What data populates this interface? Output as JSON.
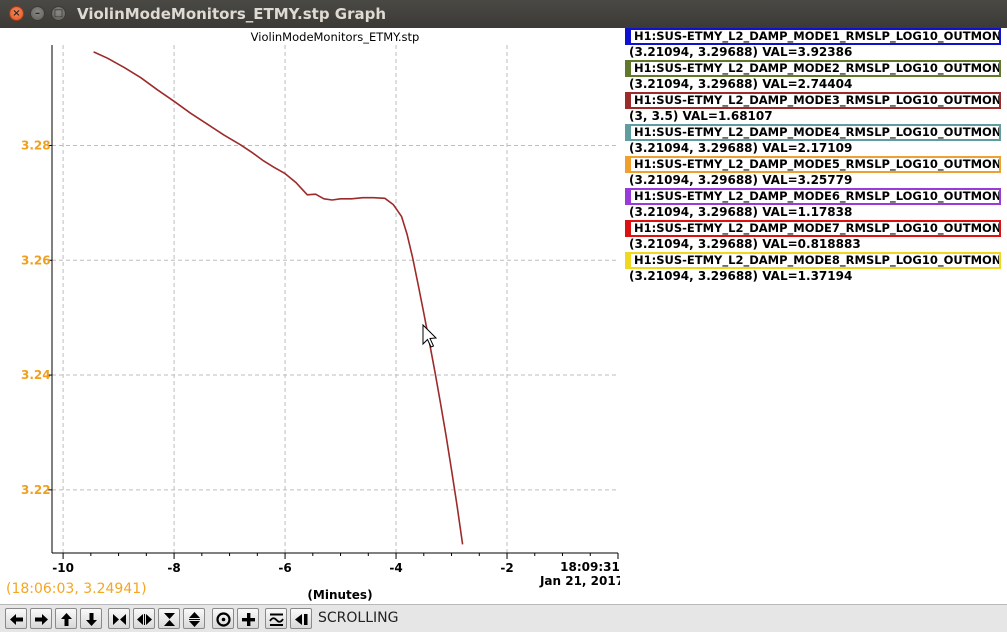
{
  "window": {
    "title": "ViolinModeMonitors_ETMY.stp Graph"
  },
  "graph": {
    "title": "ViolinModeMonitors_ETMY.stp",
    "cursor_readout": "(18:06:03, 3.24941)",
    "xlabel": "(Minutes)",
    "end_time": "18:09:31",
    "end_date": "Jan 21, 2017",
    "readout_color": "#f5a623"
  },
  "chart_data": {
    "type": "line",
    "title": "ViolinModeMonitors_ETMY.stp",
    "xlabel": "(Minutes)",
    "ylabel": "",
    "xlim": [
      -10.2,
      0
    ],
    "ylim": [
      3.209,
      3.2975
    ],
    "grid": true,
    "x_ticks": [
      -10,
      -8,
      -6,
      -4,
      -2
    ],
    "x_tick_labels": [
      "-10",
      "-8",
      "-6",
      "-4",
      "-2"
    ],
    "y_ticks": [
      3.22,
      3.24,
      3.26,
      3.28
    ],
    "y_tick_labels": [
      "3.22",
      "3.24",
      "3.26",
      "3.28"
    ],
    "series": [
      {
        "color": "#9c2b2b",
        "x": [
          -9.45,
          -9.2,
          -8.9,
          -8.6,
          -8.3,
          -8.0,
          -7.7,
          -7.4,
          -7.1,
          -6.8,
          -6.6,
          -6.4,
          -6.2,
          -6.0,
          -5.8,
          -5.6,
          -5.45,
          -5.3,
          -5.15,
          -5.0,
          -4.8,
          -4.6,
          -4.4,
          -4.2,
          -4.05,
          -3.9,
          -3.8,
          -3.7,
          -3.6,
          -3.5,
          -3.4,
          -3.3,
          -3.2,
          -3.1,
          -3.0,
          -2.9,
          -2.8
        ],
        "y": [
          3.2963,
          3.2952,
          3.2936,
          3.2918,
          3.2897,
          3.2877,
          3.2856,
          3.2837,
          3.2818,
          3.2801,
          3.2788,
          3.2774,
          3.2762,
          3.2751,
          3.2735,
          3.2714,
          3.2715,
          3.2707,
          3.2705,
          3.2707,
          3.2707,
          3.2709,
          3.2709,
          3.2708,
          3.2697,
          3.2676,
          3.2645,
          3.2604,
          3.2557,
          3.2508,
          3.2458,
          3.2406,
          3.2352,
          3.2295,
          3.2235,
          3.2172,
          3.2105
        ]
      }
    ]
  },
  "legend": [
    {
      "name": "H1:SUS-ETMY_L2_DAMP_MODE1_RMSLP_LOG10_OUTMON",
      "value": "(3.21094, 3.29688) VAL=3.92386",
      "color": "#1010d0"
    },
    {
      "name": "H1:SUS-ETMY_L2_DAMP_MODE2_RMSLP_LOG10_OUTMON",
      "value": "(3.21094, 3.29688) VAL=2.74404",
      "color": "#5e7a2a"
    },
    {
      "name": "H1:SUS-ETMY_L2_DAMP_MODE3_RMSLP_LOG10_OUTMON",
      "value": "(3, 3.5) VAL=1.68107",
      "color": "#9c2b2b"
    },
    {
      "name": "H1:SUS-ETMY_L2_DAMP_MODE4_RMSLP_LOG10_OUTMON",
      "value": "(3.21094, 3.29688) VAL=2.17109",
      "color": "#5f9ea0"
    },
    {
      "name": "H1:SUS-ETMY_L2_DAMP_MODE5_RMSLP_LOG10_OUTMON",
      "value": "(3.21094, 3.29688) VAL=3.25779",
      "color": "#f0a030"
    },
    {
      "name": "H1:SUS-ETMY_L2_DAMP_MODE6_RMSLP_LOG10_OUTMON",
      "value": "(3.21094, 3.29688) VAL=1.17838",
      "color": "#9a3ad8"
    },
    {
      "name": "H1:SUS-ETMY_L2_DAMP_MODE7_RMSLP_LOG10_OUTMON",
      "value": "(3.21094, 3.29688) VAL=0.818883",
      "color": "#dd1111"
    },
    {
      "name": "H1:SUS-ETMY_L2_DAMP_MODE8_RMSLP_LOG10_OUTMON",
      "value": "(3.21094, 3.29688) VAL=1.37194",
      "color": "#f0d820"
    }
  ],
  "toolbar": {
    "mode_label": "SCROLLING",
    "buttons": [
      "scroll-left-icon",
      "scroll-right-icon",
      "scroll-up-icon",
      "scroll-down-icon",
      "zoom-in-x-icon",
      "zoom-out-x-icon",
      "zoom-in-y-icon",
      "zoom-out-y-icon",
      "reset-icon",
      "crosshair-icon",
      "autoscale-icon",
      "scroll-to-end-icon"
    ]
  }
}
